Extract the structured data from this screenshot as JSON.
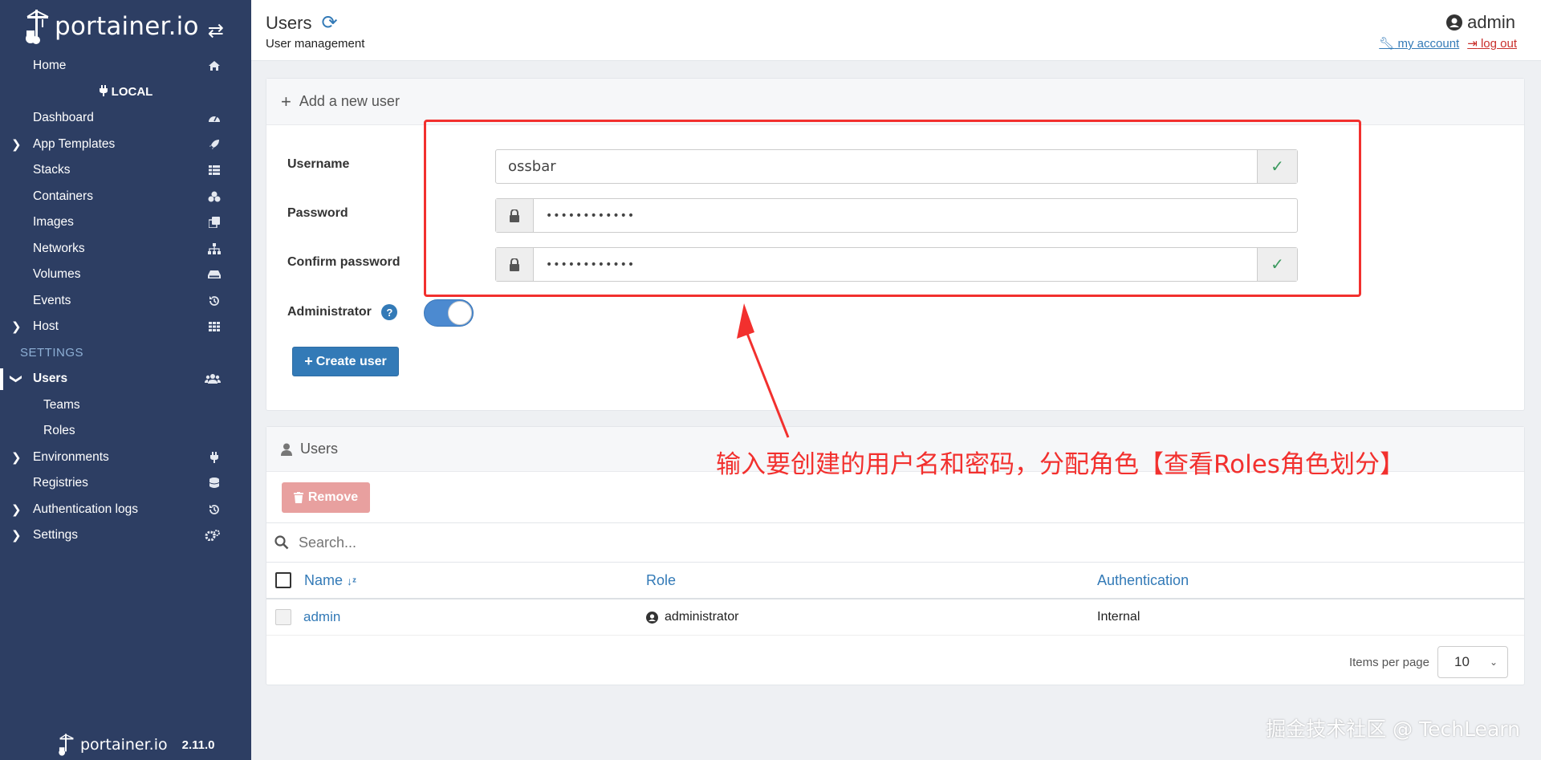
{
  "sidebar": {
    "brand": "portainer.io",
    "items": [
      {
        "label": "Home",
        "icon": "home-icon",
        "type": "item"
      },
      {
        "label": "LOCAL",
        "icon": "plug-icon",
        "type": "env"
      },
      {
        "label": "Dashboard",
        "icon": "dashboard-icon",
        "type": "item"
      },
      {
        "label": "App Templates",
        "icon": "rocket-icon",
        "type": "item",
        "chevron": true
      },
      {
        "label": "Stacks",
        "icon": "th-list-icon",
        "type": "item"
      },
      {
        "label": "Containers",
        "icon": "cubes-icon",
        "type": "item"
      },
      {
        "label": "Images",
        "icon": "clone-icon",
        "type": "item"
      },
      {
        "label": "Networks",
        "icon": "sitemap-icon",
        "type": "item"
      },
      {
        "label": "Volumes",
        "icon": "hdd-icon",
        "type": "item"
      },
      {
        "label": "Events",
        "icon": "history-icon",
        "type": "item"
      },
      {
        "label": "Host",
        "icon": "th-icon",
        "type": "item",
        "chevron": true
      },
      {
        "label": "SETTINGS",
        "type": "section"
      },
      {
        "label": "Users",
        "icon": "users-icon",
        "type": "item",
        "active": true,
        "chevron_down": true
      },
      {
        "label": "Teams",
        "type": "sub"
      },
      {
        "label": "Roles",
        "type": "sub"
      },
      {
        "label": "Environments",
        "icon": "plug-icon",
        "type": "item",
        "chevron": true
      },
      {
        "label": "Registries",
        "icon": "database-icon",
        "type": "item"
      },
      {
        "label": "Authentication logs",
        "icon": "history-icon",
        "type": "item",
        "chevron": true
      },
      {
        "label": "Settings",
        "icon": "cogs-icon",
        "type": "item",
        "chevron": true
      }
    ],
    "footer_brand": "portainer.io",
    "version": "2.11.0"
  },
  "header": {
    "title": "Users",
    "subtitle": "User management",
    "user": "admin",
    "my_account": "my account",
    "log_out": "log out"
  },
  "add_user": {
    "title": "Add a new user",
    "username_label": "Username",
    "username_value": "ossbar",
    "password_label": "Password",
    "password_value": "••••••••••••",
    "confirm_label": "Confirm password",
    "confirm_value": "••••••••••••",
    "admin_label": "Administrator",
    "admin_enabled": true,
    "create_button": "Create user"
  },
  "annotation": "输入要创建的用户名和密码，分配角色【查看Roles角色划分】",
  "users_table": {
    "title": "Users",
    "remove_button": "Remove",
    "search_placeholder": "Search...",
    "columns": [
      "Name",
      "Role",
      "Authentication"
    ],
    "rows": [
      {
        "name": "admin",
        "role": "administrator",
        "auth": "Internal"
      }
    ],
    "items_per_page_label": "Items per page",
    "items_per_page": "10"
  },
  "watermark": "掘金技术社区 @ TechLearn",
  "colors": {
    "sidebar": "#2d3e63",
    "accent": "#337ab7",
    "annotation": "#f2302e",
    "success": "#3c9a5f"
  }
}
